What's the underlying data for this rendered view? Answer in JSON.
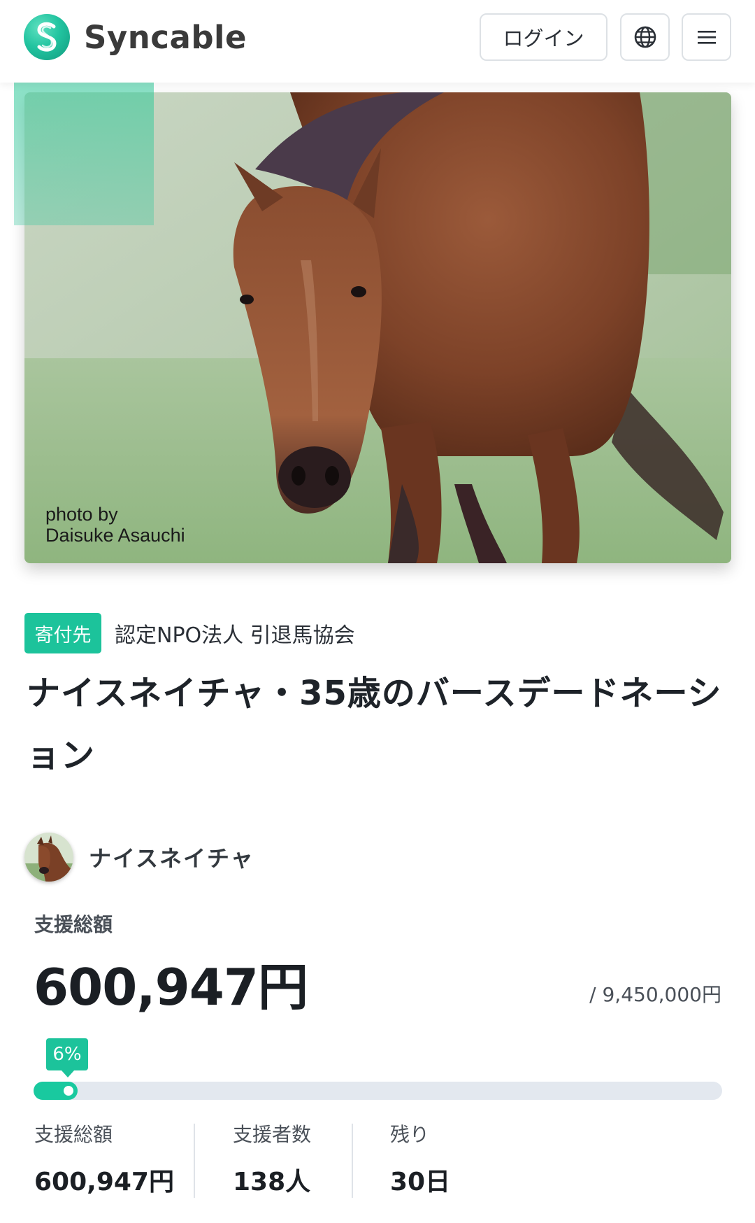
{
  "header": {
    "brand": "Syncable",
    "login_label": "ログイン",
    "globe_icon": "globe-icon",
    "menu_icon": "hamburger-menu-icon"
  },
  "hero": {
    "credit_line1": "photo by",
    "credit_line2": "Daisuke Asauchi"
  },
  "recipient": {
    "tag": "寄付先",
    "org": "認定NPO法人 引退馬協会"
  },
  "campaign": {
    "title": "ナイスネイチャ・35歳のバースデードネーション"
  },
  "owner": {
    "name": "ナイスネイチャ"
  },
  "funding": {
    "total_label": "支援総額",
    "total": "600,947円",
    "goal": "/ 9,450,000円",
    "percent_label": "6%",
    "progress_fraction": 0.064
  },
  "stats": [
    {
      "label": "支援総額",
      "value": "600,947円"
    },
    {
      "label": "支援者数",
      "value": "138人"
    },
    {
      "label": "残り",
      "value": "30日"
    }
  ],
  "colors": {
    "accent": "#1cc39b",
    "track": "#e3e8ef"
  }
}
